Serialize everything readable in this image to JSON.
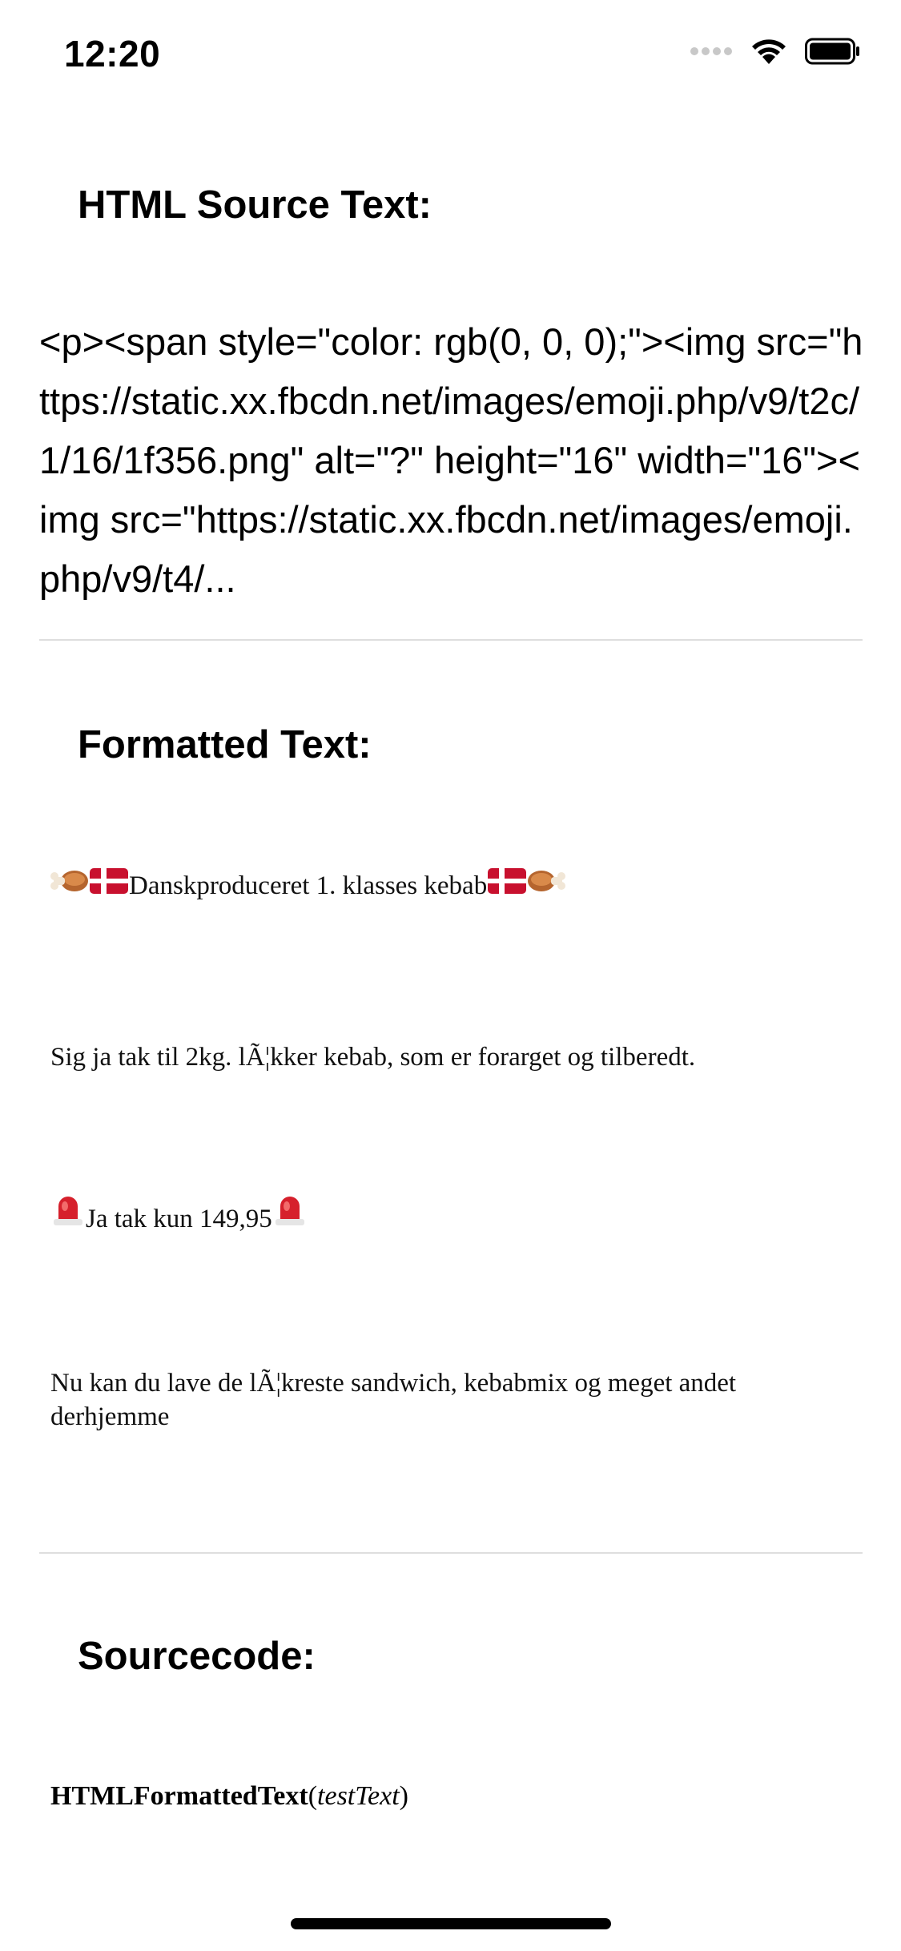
{
  "status_bar": {
    "time": "12:20",
    "icons": [
      "cellular-signal-icon",
      "wifi-icon",
      "battery-icon"
    ]
  },
  "sections": {
    "source_title": "HTML Source Text:",
    "source_text": "<p><span style=\"color: rgb(0, 0, 0);\"><img src=\"https://static.xx.fbcdn.net/images/emoji.php/v9/t2c/1/16/1f356.png\" alt=\"?\" height=\"16\" width=\"16\"><img src=\"https://static.xx.fbcdn.net/images/emoji.php/v9/t4/...",
    "formatted_title": "Formatted Text:",
    "sourcecode_title": "Sourcecode:"
  },
  "formatted": {
    "line1": "Danskproduceret 1. klasses kebab",
    "line2": "Sig ja tak til 2kg. lÃ¦kker kebab, som er forarget og tilberedt.",
    "line3": "Ja tak kun 149,95",
    "line4": "Nu kan du lave de lÃ¦kreste sandwich, kebabmix og meget andet derhjemme"
  },
  "sourcecode": {
    "function_name": "HTMLFormattedText",
    "open_paren": "(",
    "argument": "testText",
    "close_paren": ")"
  },
  "colors": {
    "divider": "#dedede",
    "flag_red": "#c8102e",
    "meat_brown": "#b5652e"
  }
}
